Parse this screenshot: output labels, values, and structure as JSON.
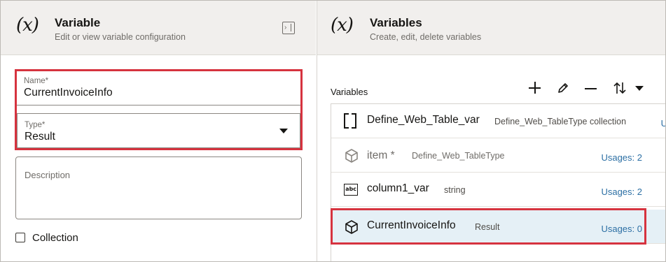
{
  "left_panel": {
    "icon_text": "(x)",
    "title": "Variable",
    "subtitle": "Edit or view variable configuration",
    "name_field": {
      "label": "Name*",
      "value": "CurrentInvoiceInfo"
    },
    "type_field": {
      "label": "Type*",
      "value": "Result"
    },
    "description_field": {
      "label": "Description",
      "value": ""
    },
    "collection_checkbox": {
      "label": "Collection",
      "checked": false
    }
  },
  "right_panel": {
    "icon_text": "(x)",
    "title": "Variables",
    "subtitle": "Create, edit, delete variables",
    "list_label": "Variables",
    "toolbar": [
      "add-icon",
      "edit-icon",
      "remove-icon",
      "sort-icon"
    ],
    "rows": [
      {
        "icon": "collection-bracket-icon",
        "name": "Define_Web_Table_var",
        "type": "Define_Web_TableType collection",
        "usage": "U"
      },
      {
        "icon": "cube-icon",
        "name": "item *",
        "type": "Define_Web_TableType",
        "usage": "Usages: 2"
      },
      {
        "icon": "abc-string-icon",
        "name": "column1_var",
        "type": "string",
        "usage": "Usages: 2"
      },
      {
        "icon": "cube-icon",
        "name": "CurrentInvoiceInfo",
        "type": "Result",
        "usage": "Usages: 0"
      }
    ]
  },
  "colors": {
    "header_bg": "#f1efed",
    "highlight_border": "#d6333f",
    "selected_row_bg": "#e5f0f6",
    "link_blue": "#2c6fa4"
  }
}
